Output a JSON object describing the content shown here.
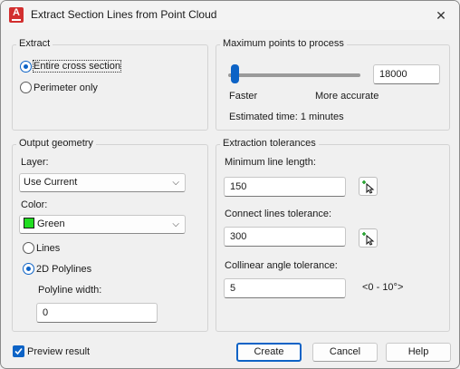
{
  "window": {
    "title": "Extract Section Lines from Point Cloud",
    "app_icon_letter": "A"
  },
  "extract": {
    "group_title": "Extract",
    "options": [
      {
        "label": "Entire cross section",
        "selected": true
      },
      {
        "label": "Perimeter only",
        "selected": false
      }
    ]
  },
  "max_points": {
    "group_title": "Maximum points to process",
    "value": "18000",
    "slider_level_fraction": 0.05,
    "faster_label": "Faster",
    "accurate_label": "More accurate",
    "estimated_label": "Estimated time:",
    "estimated_value": "1 minutes"
  },
  "output": {
    "group_title": "Output geometry",
    "layer_label": "Layer:",
    "layer_value": "Use Current",
    "color_label": "Color:",
    "color_value": "Green",
    "color_swatch": "#22dd22",
    "geometry_options": [
      {
        "label": "Lines",
        "selected": false
      },
      {
        "label": "2D Polylines",
        "selected": true
      }
    ],
    "polyline_width_label": "Polyline width:",
    "polyline_width_value": "0"
  },
  "tolerances": {
    "group_title": "Extraction tolerances",
    "min_length_label": "Minimum line length:",
    "min_length_value": "150",
    "connect_label": "Connect lines tolerance:",
    "connect_value": "300",
    "collinear_label": "Collinear angle tolerance:",
    "collinear_value": "5",
    "collinear_range": "<0 - 10°>"
  },
  "footer": {
    "preview_label": "Preview result",
    "preview_checked": true,
    "create_label": "Create",
    "cancel_label": "Cancel",
    "help_label": "Help"
  },
  "colors": {
    "accent": "#0d63c6",
    "app_icon": "#d22f2f"
  }
}
